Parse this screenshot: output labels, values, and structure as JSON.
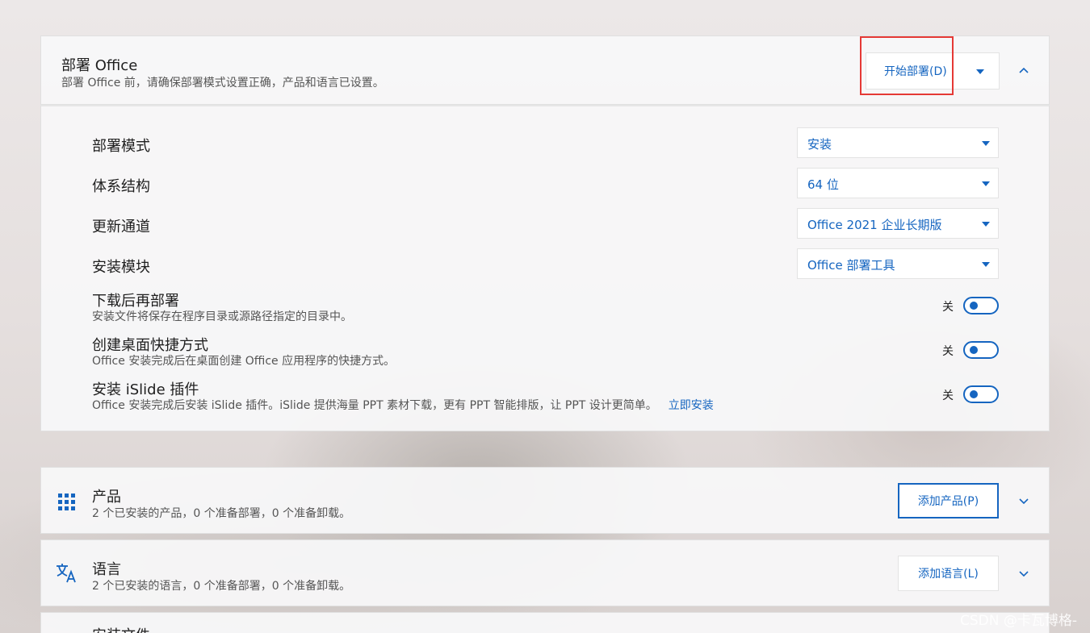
{
  "deploy": {
    "title": "部署 Office",
    "desc": "部署 Office 前，请确保部署模式设置正确，产品和语言已设置。",
    "start_button": "开始部署(D)",
    "settings": [
      {
        "label": "部署模式",
        "value": "安装"
      },
      {
        "label": "体系结构",
        "value": "64 位"
      },
      {
        "label": "更新通道",
        "value": "Office 2021 企业长期版"
      },
      {
        "label": "安装模块",
        "value": "Office 部署工具"
      }
    ],
    "toggles": [
      {
        "title": "下载后再部署",
        "desc": "安装文件将保存在程序目录或源路径指定的目录中。",
        "state": "关"
      },
      {
        "title": "创建桌面快捷方式",
        "desc": "Office 安装完成后在桌面创建 Office 应用程序的快捷方式。",
        "state": "关"
      },
      {
        "title": "安装 iSlide 插件",
        "desc": "Office 安装完成后安装 iSlide 插件。iSlide 提供海量 PPT 素材下载，更有 PPT 智能排版，让 PPT 设计更简单。",
        "link": "立即安装",
        "state": "关"
      }
    ]
  },
  "products": {
    "title": "产品",
    "desc": "2 个已安装的产品，0 个准备部署，0 个准备卸载。",
    "button": "添加产品(P)",
    "icon": "grid-icon"
  },
  "languages": {
    "title": "语言",
    "desc": "2 个已安装的语言，0 个准备部署，0 个准备卸载。",
    "button": "添加语言(L)",
    "icon": "translate-icon"
  },
  "install_files": {
    "title": "安装文件"
  },
  "watermark": "CSDN @卡瓦博格-",
  "colors": {
    "accent": "#1565c0",
    "highlight": "#e53935"
  }
}
